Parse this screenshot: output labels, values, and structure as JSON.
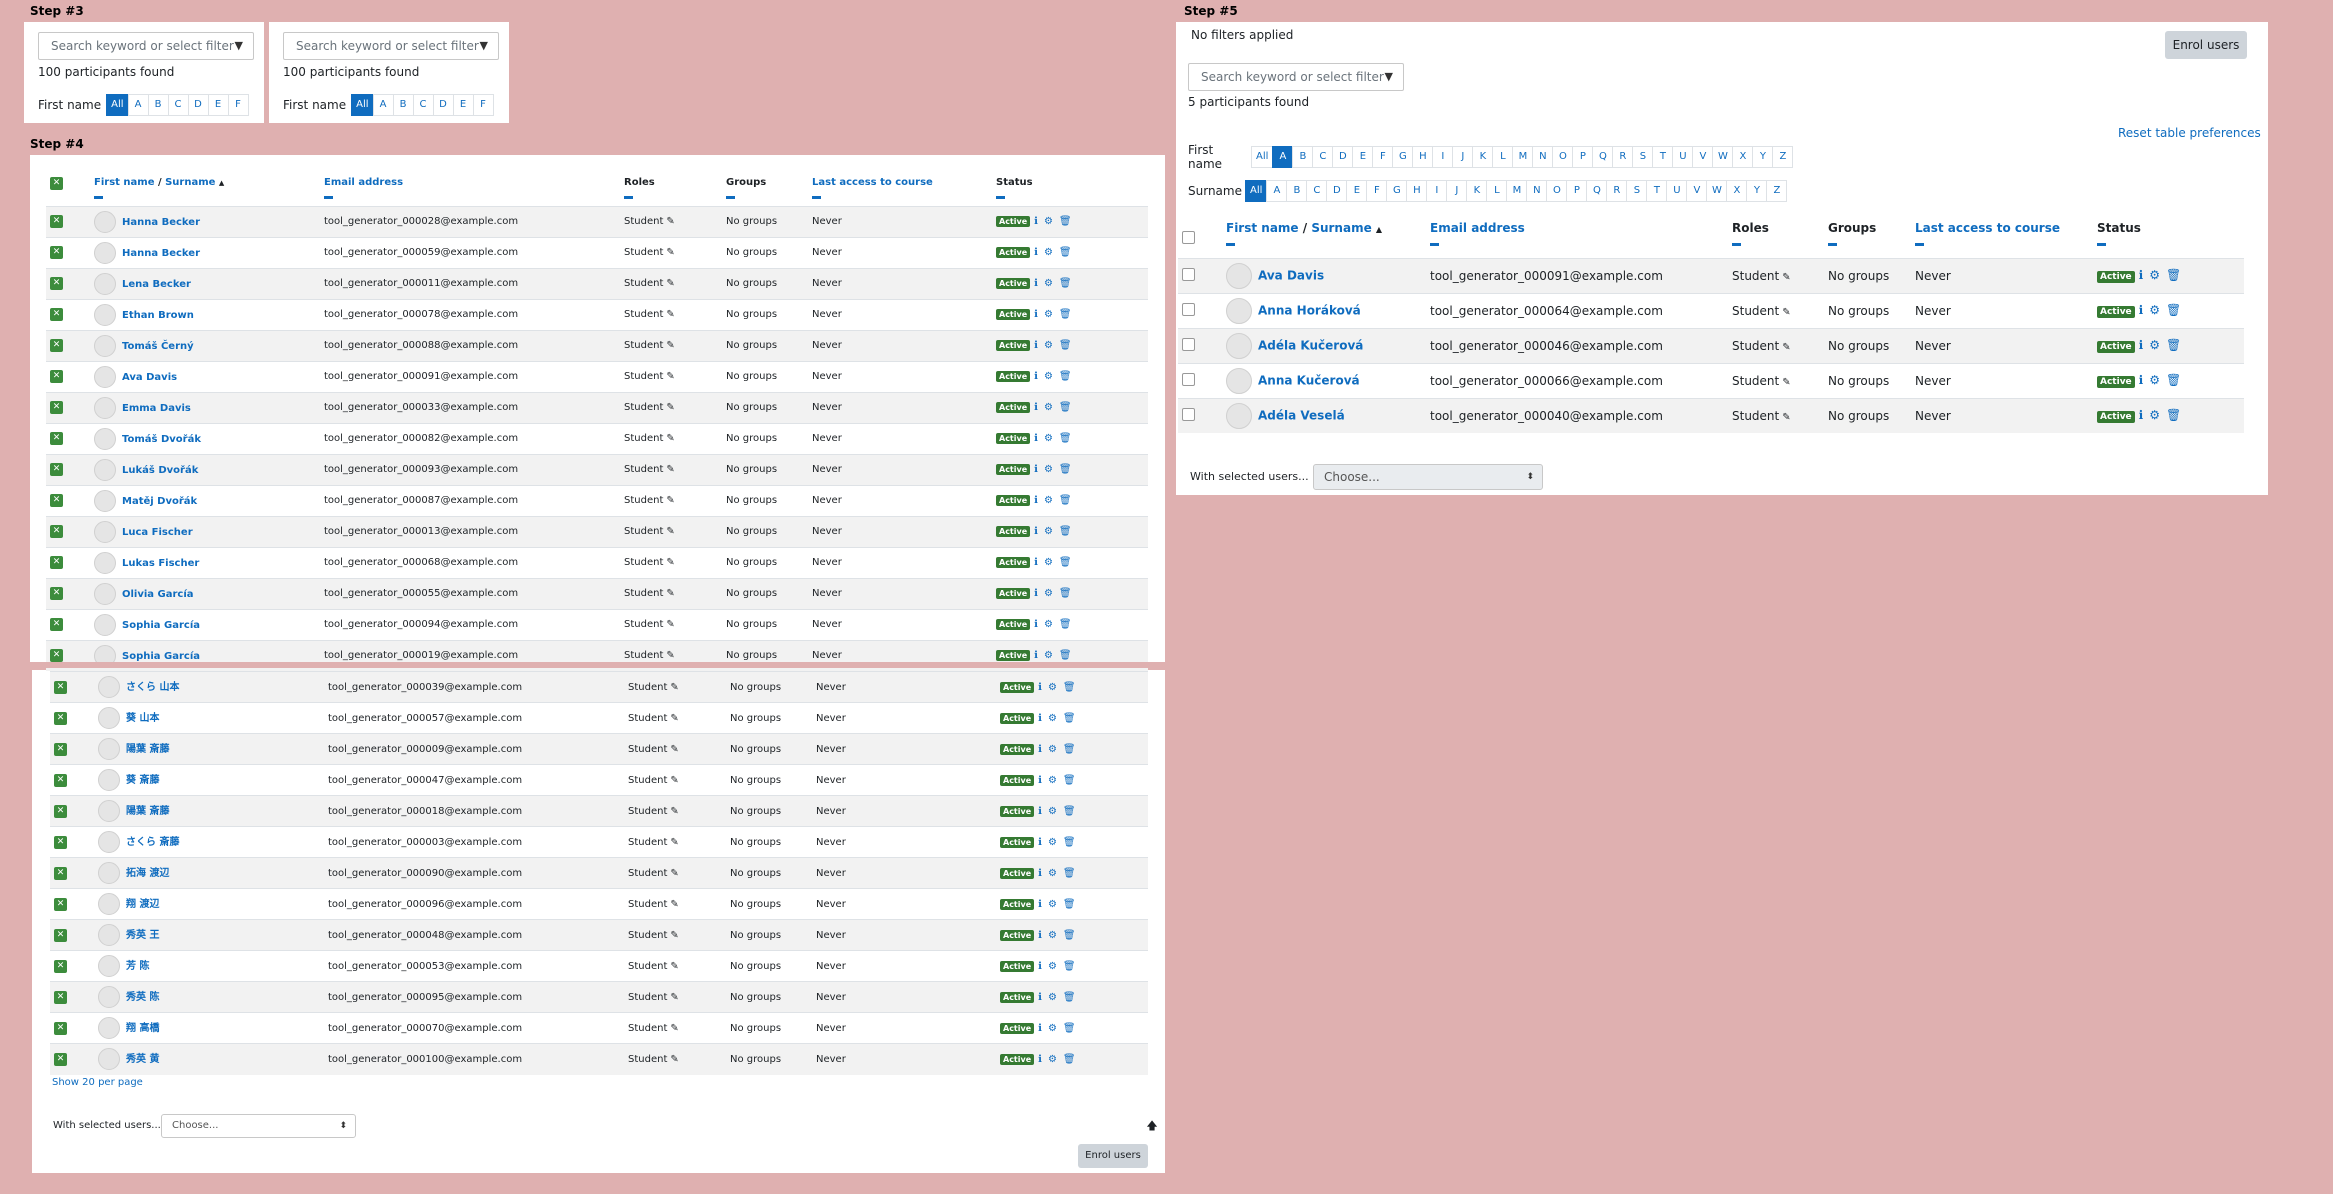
{
  "steps": {
    "s3": "Step #3",
    "s4": "Step #4",
    "s5": "Step #5"
  },
  "search_placeholder": "Search keyword or select filter",
  "step3": {
    "found": "100 participants found",
    "firstname_label": "First name",
    "letters_a": [
      "All",
      "A",
      "B",
      "C",
      "D",
      "E",
      "F"
    ],
    "letters_b": [
      "All",
      "A",
      "B",
      "C",
      "D",
      "E",
      "F"
    ]
  },
  "step4": {
    "headers": {
      "firstname": "First name",
      "sep": " / ",
      "surname": "Surname",
      "sort": "▲",
      "email": "Email address",
      "roles": "Roles",
      "groups": "Groups",
      "lastaccess": "Last access to course",
      "status": "Status"
    },
    "rows_top": [
      {
        "name": "Hanna Becker",
        "email": "tool_generator_000028@example.com"
      },
      {
        "name": "Hanna Becker",
        "email": "tool_generator_000059@example.com"
      },
      {
        "name": "Lena Becker",
        "email": "tool_generator_000011@example.com"
      },
      {
        "name": "Ethan Brown",
        "email": "tool_generator_000078@example.com"
      },
      {
        "name": "Tomáš Černý",
        "email": "tool_generator_000088@example.com"
      },
      {
        "name": "Ava Davis",
        "email": "tool_generator_000091@example.com"
      },
      {
        "name": "Emma Davis",
        "email": "tool_generator_000033@example.com"
      },
      {
        "name": "Tomáš Dvořák",
        "email": "tool_generator_000082@example.com"
      },
      {
        "name": "Lukáš Dvořák",
        "email": "tool_generator_000093@example.com"
      },
      {
        "name": "Matěj Dvořák",
        "email": "tool_generator_000087@example.com"
      },
      {
        "name": "Luca Fischer",
        "email": "tool_generator_000013@example.com"
      },
      {
        "name": "Lukas Fischer",
        "email": "tool_generator_000068@example.com"
      },
      {
        "name": "Olivia García",
        "email": "tool_generator_000055@example.com"
      },
      {
        "name": "Sophia García",
        "email": "tool_generator_000094@example.com"
      },
      {
        "name": "Sophia García",
        "email": "tool_generator_000019@example.com"
      }
    ],
    "rows_bottom": [
      {
        "name": "さくら 山本",
        "email": "tool_generator_000039@example.com"
      },
      {
        "name": "葵 山本",
        "email": "tool_generator_000057@example.com"
      },
      {
        "name": "陽葉 斎藤",
        "email": "tool_generator_000009@example.com"
      },
      {
        "name": "葵 斎藤",
        "email": "tool_generator_000047@example.com"
      },
      {
        "name": "陽葉 斎藤",
        "email": "tool_generator_000018@example.com"
      },
      {
        "name": "さくら 斎藤",
        "email": "tool_generator_000003@example.com"
      },
      {
        "name": "拓海 渡辺",
        "email": "tool_generator_000090@example.com"
      },
      {
        "name": "翔 渡辺",
        "email": "tool_generator_000096@example.com"
      },
      {
        "name": "秀英 王",
        "email": "tool_generator_000048@example.com"
      },
      {
        "name": "芳 陈",
        "email": "tool_generator_000053@example.com"
      },
      {
        "name": "秀英 陈",
        "email": "tool_generator_000095@example.com"
      },
      {
        "name": "翔 高橋",
        "email": "tool_generator_000070@example.com"
      },
      {
        "name": "秀英 黄",
        "email": "tool_generator_000100@example.com"
      }
    ],
    "role": "Student",
    "groups": "No groups",
    "never": "Never",
    "active": "Active",
    "show_per_page": "Show 20 per page",
    "with_selected": "With selected users...",
    "choose": "Choose...",
    "enrol": "Enrol users"
  },
  "step5": {
    "no_filters": "No filters applied",
    "enrol": "Enrol users",
    "found": "5 participants found",
    "reset": "Reset table preferences",
    "firstname_label": "First name",
    "surname_label": "Surname",
    "letters_first": [
      "All",
      "A",
      "B",
      "C",
      "D",
      "E",
      "F",
      "G",
      "H",
      "I",
      "J",
      "K",
      "L",
      "M",
      "N",
      "O",
      "P",
      "Q",
      "R",
      "S",
      "T",
      "U",
      "V",
      "W",
      "X",
      "Y",
      "Z"
    ],
    "letters_sur": [
      "All",
      "A",
      "B",
      "C",
      "D",
      "E",
      "F",
      "G",
      "H",
      "I",
      "J",
      "K",
      "L",
      "M",
      "N",
      "O",
      "P",
      "Q",
      "R",
      "S",
      "T",
      "U",
      "V",
      "W",
      "X",
      "Y",
      "Z"
    ],
    "rows": [
      {
        "name": "Ava Davis",
        "email": "tool_generator_000091@example.com"
      },
      {
        "name": "Anna Horáková",
        "email": "tool_generator_000064@example.com"
      },
      {
        "name": "Adéla Kučerová",
        "email": "tool_generator_000046@example.com"
      },
      {
        "name": "Anna Kučerová",
        "email": "tool_generator_000066@example.com"
      },
      {
        "name": "Adéla Veselá",
        "email": "tool_generator_000040@example.com"
      }
    ],
    "with_selected": "With selected users...",
    "choose": "Choose..."
  },
  "icons": {
    "check": "✕",
    "pencil": "✎",
    "info": "ℹ",
    "gear": "⚙",
    "trash": "🗑",
    "caret": "▼",
    "updown": "⬍",
    "up": "🡅"
  }
}
